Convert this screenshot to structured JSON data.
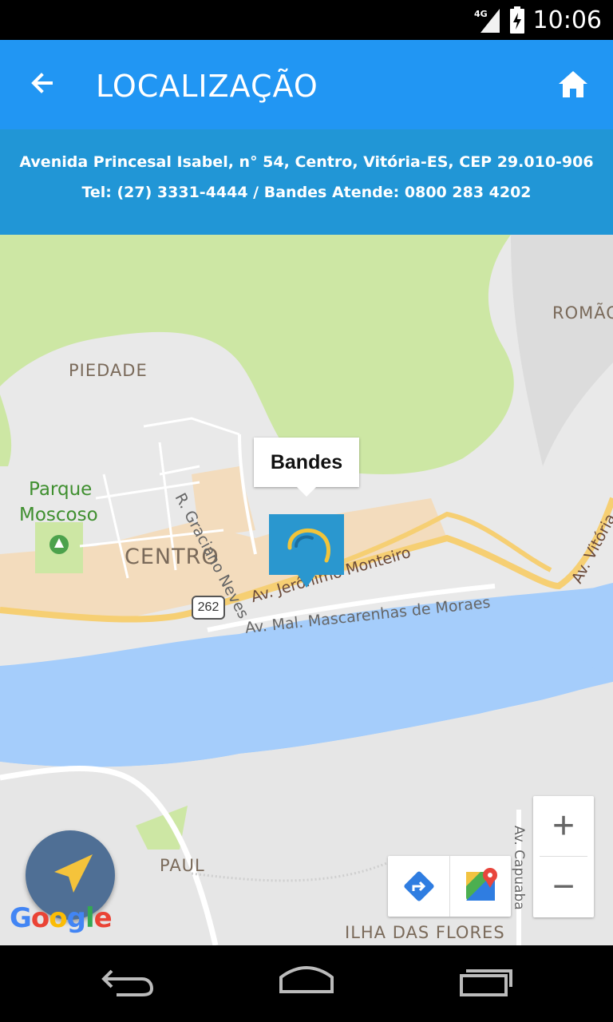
{
  "status": {
    "network": "4G",
    "time": "10:06"
  },
  "appbar": {
    "title": "LOCALIZAÇÃO"
  },
  "address": {
    "line1": "Avenida Princesal Isabel, n° 54, Centro, Vitória-ES, CEP 29.010-906",
    "line2": "Tel: (27) 3331-4444 / Bandes Atende: 0800 283 4202"
  },
  "map": {
    "places": {
      "piedade": "PIEDADE",
      "romao": "ROMÃO",
      "centro": "CENTRO",
      "paul": "PAUL",
      "ilha_das_flores": "ILHA DAS FLORES",
      "parque_line1": "Parque",
      "parque_line2": "Moscoso"
    },
    "streets": {
      "graciano": "R. Graciano Neves",
      "jeronimo": "Av. Jerônimo Monteiro",
      "mascarenhas": "Av. Mal. Mascarenhas de Moraes",
      "vitoria": "Av. Vitória",
      "capuaba": "Av. Capuaba"
    },
    "route_shield": "262",
    "marker_title": "Bandes",
    "zoom_in": "+",
    "zoom_out": "−",
    "attribution": "Google"
  },
  "colors": {
    "primary": "#2196f3",
    "address_bg": "#2196d6",
    "water": "#a5cdfb",
    "park": "#cde7a4",
    "road": "#f6cf73",
    "fab": "#4f6f95",
    "locate_arrow": "#f5c33b"
  }
}
